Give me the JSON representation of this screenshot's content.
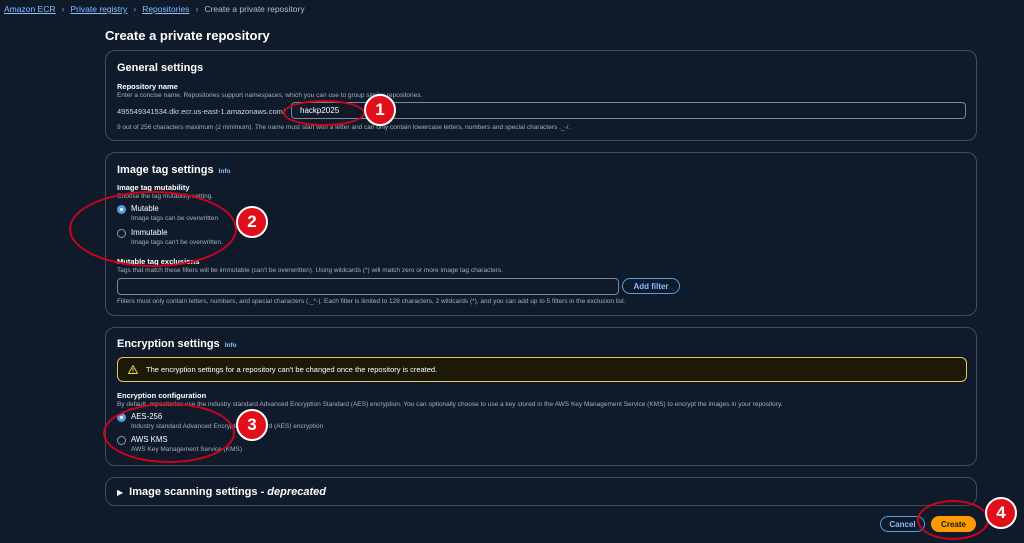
{
  "breadcrumb": {
    "items": [
      "Amazon ECR",
      "Private registry",
      "Repositories"
    ],
    "current": "Create a private repository"
  },
  "page_title": "Create a private repository",
  "general_settings": {
    "title": "General settings",
    "repo_name_label": "Repository name",
    "repo_name_desc": "Enter a concise name. Repositories support namespaces, which you can use to group similar repositories.",
    "registry_prefix": "495549341534.dkr.ecr.us-east-1.amazonaws.com/",
    "repo_name_value": "hackp2025",
    "repo_name_hint": "9 out of 256 characters maximum (2 minimum). The name must start with a letter and can only contain lowercase letters, numbers and special characters ._-/."
  },
  "image_tag_settings": {
    "title": "Image tag settings",
    "info": "Info",
    "mutability_label": "Image tag mutability",
    "mutability_desc": "Choose the tag mutability setting.",
    "options": [
      {
        "label": "Mutable",
        "desc": "Image tags can be overwritten",
        "checked": true
      },
      {
        "label": "Immutable",
        "desc": "Image tags can't be overwritten.",
        "checked": false
      }
    ],
    "exclusions_label": "Mutable tag exclusions",
    "exclusions_desc": "Tags that match these filters will be immutable (can't be overwritten). Using wildcards (*) will match zero or more image tag characters.",
    "exclusions_value": "",
    "add_filter_label": "Add filter",
    "exclusions_hint": "Filters must only contain letters, numbers, and special characters (._*-). Each filter is limited to 128 characters, 2 wildcards (*), and you can add up to 5 filters in the exclusion list."
  },
  "encryption_settings": {
    "title": "Encryption settings",
    "info": "Info",
    "warning_text": "The encryption settings for a repository can't be changed once the repository is created.",
    "config_label": "Encryption configuration",
    "config_desc": "By default, repositories use the industry standard Advanced Encryption Standard (AES) encryption. You can optionally choose to use a key stored in the AWS Key Management Service (KMS) to encrypt the images in your repository.",
    "options": [
      {
        "label": "AES-256",
        "desc": "Industry standard Advanced Encryption Standard (AES) encryption",
        "checked": true
      },
      {
        "label": "AWS KMS",
        "desc": "AWS Key Management Service (KMS)",
        "checked": false
      }
    ]
  },
  "image_scanning": {
    "title_main": "Image scanning settings - ",
    "title_em": "deprecated"
  },
  "footer": {
    "cancel_label": "Cancel",
    "create_label": "Create"
  },
  "annotations": [
    "1",
    "2",
    "3",
    "4"
  ],
  "colors": {
    "background": "#0f1b2a",
    "link": "#89bdff",
    "primary_button": "#ff9900",
    "annotation": "#e0101b",
    "warning_border": "#e0ca57"
  }
}
